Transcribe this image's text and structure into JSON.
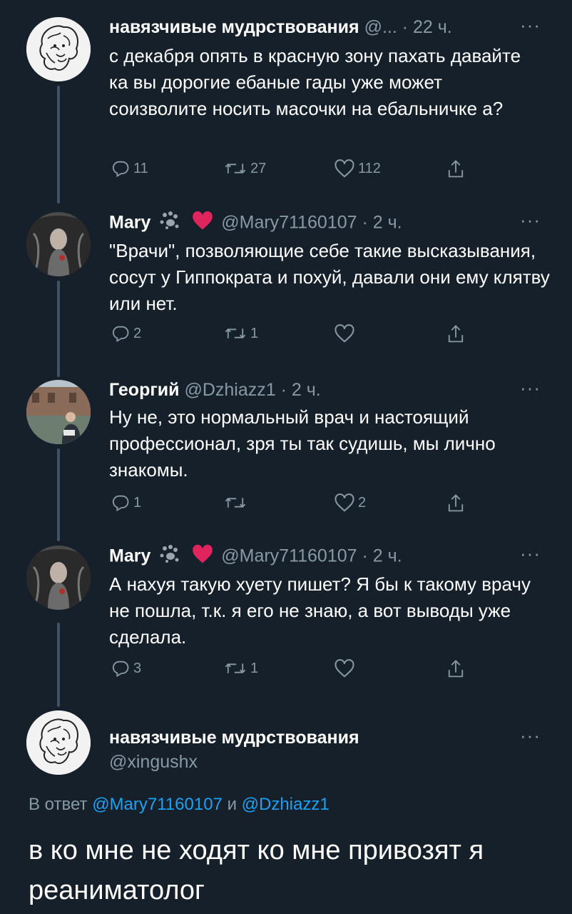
{
  "tweets": [
    {
      "name": "навязчивые мудрствования",
      "handle": "@...",
      "time": "· 22 ч.",
      "more": "···",
      "text": "с декабря опять в красную зону пахать давайте ка вы дорогие ебаные гады уже может соизволите носить масочки на ебальничке а?",
      "replies": "11",
      "retweets": "27",
      "likes": "112"
    },
    {
      "name": "Mary",
      "handle": "@Mary71160107",
      "time": "· 2 ч.",
      "more": "···",
      "text": "\"Врачи\", позволяющие себе такие высказывания, сосут у Гиппократа и похуй, давали они ему клятву или нет.",
      "replies": "2",
      "retweets": "1",
      "likes": ""
    },
    {
      "name": "Георгий",
      "handle": "@Dzhiazz1",
      "time": "· 2 ч.",
      "more": "···",
      "text": "Ну не, это нормальный врач и настоящий профессионал, зря ты так судишь, мы лично знакомы.",
      "replies": "1",
      "retweets": "",
      "likes": "2"
    },
    {
      "name": "Mary",
      "handle": "@Mary71160107",
      "time": "· 2 ч.",
      "more": "···",
      "text": "А нахуя такую хуету пишет? Я бы к такому врачу не пошла, т.к. я его не знаю, а вот выводы уже сделала.",
      "replies": "3",
      "retweets": "1",
      "likes": ""
    }
  ],
  "main": {
    "name": "навязчивые мудрствования",
    "handle": "@xingushx",
    "more": "···",
    "reply_prefix": "В ответ",
    "reply_user1": "@Mary71160107",
    "reply_and": "и",
    "reply_user2": "@Dzhiazz1",
    "text": "в ко мне не ходят ко мне привозят я реаниматолог"
  },
  "colors": {
    "background": "#15202b",
    "secondary_text": "#8899a6",
    "link": "#1da1f2",
    "heart": "#e0245e"
  }
}
